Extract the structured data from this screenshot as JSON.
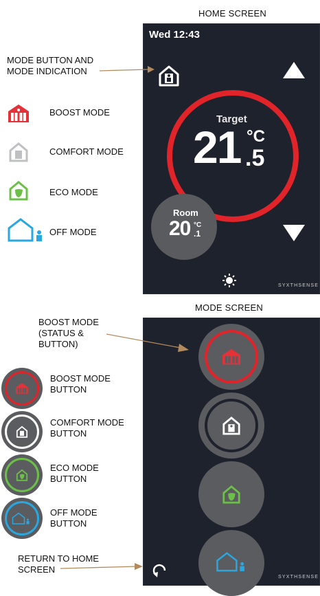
{
  "home": {
    "section_title": "HOME SCREEN",
    "datetime": "Wed 12:43",
    "target_label": "Target",
    "target_int": "21",
    "target_dec": ".5",
    "unit": "°C",
    "room_label": "Room",
    "room_int": "20",
    "room_dec": ".1",
    "room_unit": "°C",
    "brand": "SYXTHSENSE"
  },
  "mode_screen": {
    "section_title": "MODE SCREEN",
    "brand": "SYXTHSENSE"
  },
  "annotations": {
    "mode_button_line1": "MODE BUTTON AND",
    "mode_button_line2": "MODE INDICATION",
    "boost_status_line1": "BOOST MODE",
    "boost_status_line2": "(STATUS &",
    "boost_status_line3": "BUTTON)",
    "return_line1": "RETURN TO HOME",
    "return_line2": "SCREEN"
  },
  "legend_modes": [
    {
      "label": "BOOST MODE",
      "icon": "boost-house-icon",
      "color": "#e53238"
    },
    {
      "label": "COMFORT MODE",
      "icon": "comfort-house-icon",
      "color": "#bfc0c2"
    },
    {
      "label": "ECO MODE",
      "icon": "eco-house-icon",
      "color": "#6cc04a"
    },
    {
      "label": "OFF MODE",
      "icon": "off-house-icon",
      "color": "#2aa7df"
    }
  ],
  "legend_buttons": [
    {
      "line1": "BOOST MODE",
      "line2": "BUTTON"
    },
    {
      "line1": "COMFORT MODE",
      "line2": "BUTTON"
    },
    {
      "line1": "ECO MODE",
      "line2": "BUTTON"
    },
    {
      "line1": "OFF MODE",
      "line2": "BUTTON"
    }
  ],
  "colors": {
    "screen_bg": "#1e222c",
    "ring_red": "#e0242a",
    "circle_grey": "#5a5b5f",
    "arrow_annot": "#b38a5e",
    "boost": "#e53238",
    "comfort": "#bfc0c2",
    "eco": "#6cc04a",
    "off": "#2aa7df"
  }
}
